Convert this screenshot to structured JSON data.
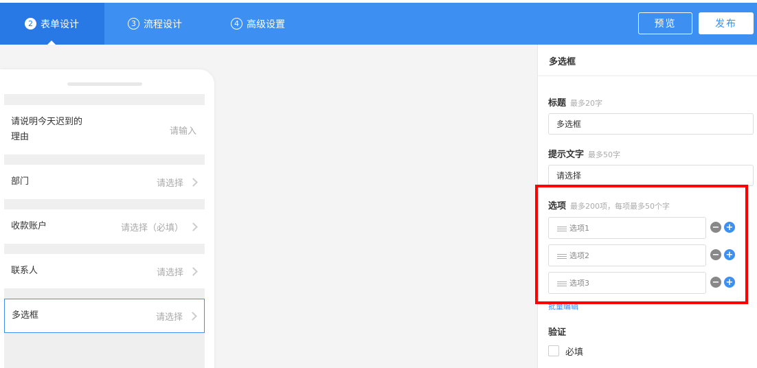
{
  "steps": [
    {
      "num": "2",
      "label": "表单设计"
    },
    {
      "num": "3",
      "label": "流程设计"
    },
    {
      "num": "4",
      "label": "高级设置"
    }
  ],
  "actions": {
    "preview": "预览",
    "publish": "发布"
  },
  "phone": {
    "rows": [
      {
        "label": "请说明今天迟到的理由",
        "placeholder": "请输入"
      },
      {
        "label": "部门",
        "placeholder": "请选择"
      },
      {
        "label": "收款账户",
        "placeholder": "请选择（必填）"
      },
      {
        "label": "联系人",
        "placeholder": "请选择"
      },
      {
        "label": "多选框",
        "placeholder": "请选择"
      }
    ]
  },
  "panel": {
    "title": "多选框",
    "title_field": {
      "label": "标题",
      "hint": "最多20字",
      "value": "多选框"
    },
    "prompt_field": {
      "label": "提示文字",
      "hint": "最多50字",
      "value": "请选择"
    },
    "options_field": {
      "label": "选项",
      "hint": "最多200项，每项最多50个字",
      "options": [
        "选项1",
        "选项2",
        "选项3"
      ],
      "batch_edit": "批量编辑"
    },
    "validation": {
      "label": "验证",
      "required_label": "必填",
      "required_checked": false
    }
  },
  "colors": {
    "primary": "#3d8ff2",
    "active_tab": "#2878e6",
    "highlight": "#ff0000"
  }
}
